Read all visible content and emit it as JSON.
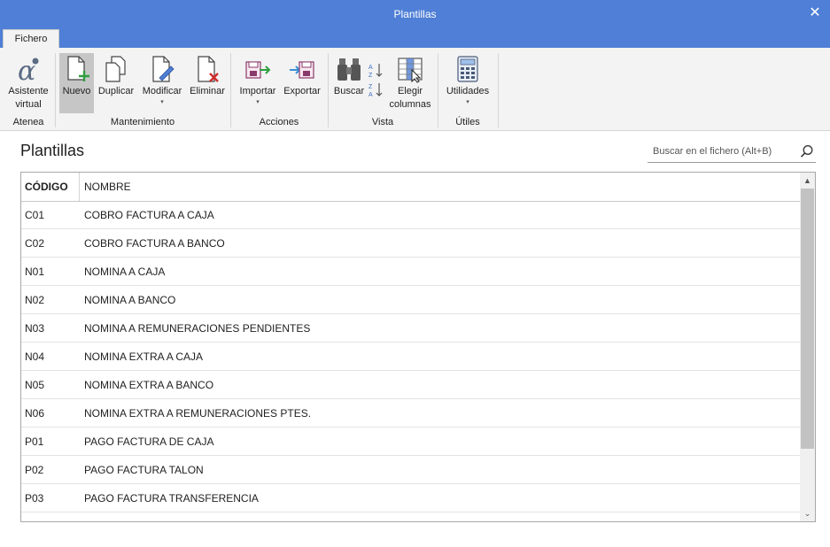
{
  "window": {
    "title": "Plantillas",
    "close_glyph": "✕"
  },
  "tabs": [
    {
      "label": "Fichero"
    }
  ],
  "ribbon": {
    "asistente": {
      "line1": "Asistente",
      "line2": "virtual"
    },
    "nuevo": "Nuevo",
    "duplicar": "Duplicar",
    "modificar": "Modificar",
    "eliminar": "Eliminar",
    "importar": "Importar",
    "exportar": "Exportar",
    "buscar": "Buscar",
    "elegir": {
      "line1": "Elegir",
      "line2": "columnas"
    },
    "utilidades": "Utilidades",
    "caret": "▾",
    "groups": {
      "atenea": "Atenea",
      "mantenimiento": "Mantenimiento",
      "acciones": "Acciones",
      "vista": "Vista",
      "utiles": "Útiles"
    },
    "colors": {
      "accent_blue": "#4f7fd6",
      "add_green": "#2e9e3f",
      "delete_red": "#d12a2a"
    }
  },
  "main": {
    "title": "Plantillas",
    "search_placeholder": "Buscar en el fichero (Alt+B)"
  },
  "table": {
    "columns": [
      "CÓDIGO",
      "NOMBRE"
    ],
    "rows": [
      [
        "C01",
        "COBRO FACTURA A CAJA"
      ],
      [
        "C02",
        "COBRO FACTURA A BANCO"
      ],
      [
        "N01",
        "NOMINA A CAJA"
      ],
      [
        "N02",
        "NOMINA A BANCO"
      ],
      [
        "N03",
        "NOMINA A REMUNERACIONES PENDIENTES"
      ],
      [
        "N04",
        "NOMINA EXTRA A CAJA"
      ],
      [
        "N05",
        "NOMINA EXTRA A BANCO"
      ],
      [
        "N06",
        "NOMINA EXTRA A REMUNERACIONES PTES."
      ],
      [
        "P01",
        "PAGO FACTURA DE CAJA"
      ],
      [
        "P02",
        "PAGO FACTURA TALON"
      ],
      [
        "P03",
        "PAGO FACTURA TRANSFERENCIA"
      ]
    ]
  },
  "scrollbar": {
    "up_glyph": "▲",
    "down_glyph": "⌄"
  }
}
